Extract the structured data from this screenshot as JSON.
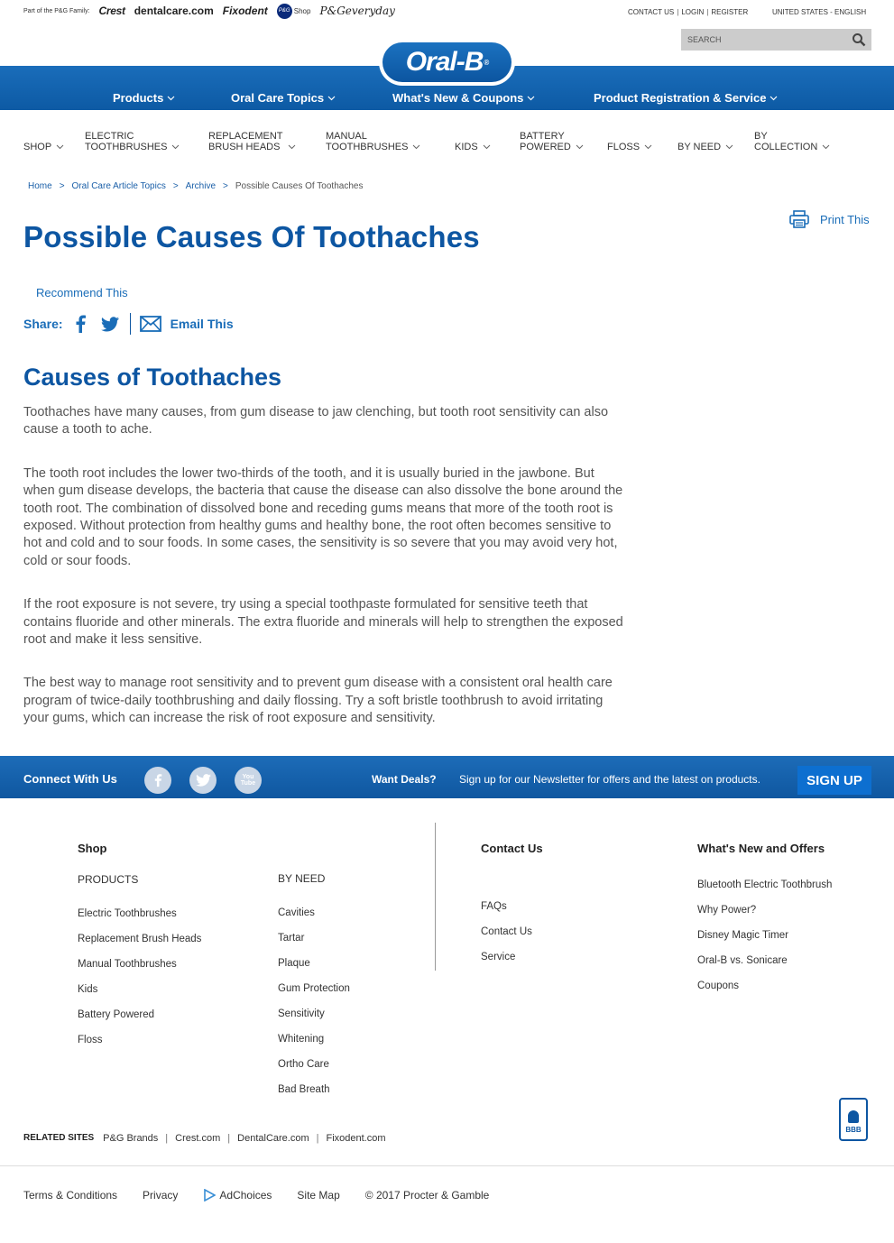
{
  "family": {
    "part_of": "Part of the P&G Family:",
    "brands": [
      "Crest",
      "dentalcare.com",
      "Fixodent",
      "Shop",
      "P&Geveryday"
    ],
    "pg_dot": "P&G"
  },
  "util": {
    "contact": "CONTACT US",
    "login": "LOGIN",
    "register": "REGISTER",
    "sep": "|",
    "locale": "UNITED STATES - ENGLISH"
  },
  "search": {
    "placeholder": "SEARCH"
  },
  "logo": {
    "text": "Oral-B",
    "reg": "®"
  },
  "mainnav": [
    {
      "label": "Products"
    },
    {
      "label": "Oral Care Topics"
    },
    {
      "label": "What's New & Coupons"
    },
    {
      "label": "Product Registration & Service"
    }
  ],
  "catnav": [
    {
      "l1": "",
      "l2": "SHOP"
    },
    {
      "l1": "ELECTRIC",
      "l2": "TOOTHBRUSHES"
    },
    {
      "l1": "REPLACEMENT",
      "l2": "BRUSH HEADS"
    },
    {
      "l1": "MANUAL",
      "l2": "TOOTHBRUSHES"
    },
    {
      "l1": "",
      "l2": "KIDS"
    },
    {
      "l1": "BATTERY",
      "l2": "POWERED"
    },
    {
      "l1": "",
      "l2": "FLOSS"
    },
    {
      "l1": "",
      "l2": "BY NEED"
    },
    {
      "l1": "BY",
      "l2": "COLLECTION"
    }
  ],
  "breadcrumb": {
    "items": [
      "Home",
      "Oral Care Article Topics",
      "Archive"
    ],
    "current": "Possible Causes Of Toothaches",
    "sep": ">"
  },
  "print": "Print This",
  "title": "Possible Causes Of Toothaches",
  "recommend": "Recommend This",
  "share": {
    "label": "Share:",
    "email": "Email This"
  },
  "subtitle": "Causes of Toothaches",
  "paragraphs": [
    "Toothaches have many causes, from gum disease to jaw clenching, but tooth root sensitivity can also cause a tooth to ache.",
    "The tooth root includes the lower two-thirds of the tooth, and it is usually buried in the jawbone. But when gum disease develops, the bacteria that cause the disease can also dissolve the bone around the tooth root. The combination of dissolved bone and receding gums means that more of the tooth root is exposed. Without protection from healthy gums and healthy bone, the root often becomes sensitive to hot and cold and to sour foods. In some cases, the sensitivity is so severe that you may avoid very hot, cold or sour foods.",
    "If the root exposure is not severe, try using a special toothpaste formulated for sensitive teeth that contains fluoride and other minerals. The extra fluoride and minerals will help to strengthen the exposed root and make it less sensitive.",
    "The best way to manage root sensitivity and to prevent gum disease with a consistent oral health care program of twice-daily toothbrushing and daily flossing. Try a soft bristle toothbrush to avoid irritating your gums, which can increase the risk of root exposure and sensitivity."
  ],
  "connect": {
    "label": "Connect With Us",
    "youtube": "You Tube",
    "deals": "Want Deals?",
    "newsletter": "Sign up for our Newsletter for offers and the latest on products.",
    "signup": "SIGN UP"
  },
  "footer": {
    "shop": "Shop",
    "products_head": "PRODUCTS",
    "products": [
      "Electric Toothbrushes",
      "Replacement Brush Heads",
      "Manual Toothbrushes",
      "Kids",
      "Battery Powered",
      "Floss"
    ],
    "byneed_head": "BY NEED",
    "byneed": [
      "Cavities",
      "Tartar",
      "Plaque",
      "Gum Protection",
      "Sensitivity",
      "Whitening",
      "Ortho Care",
      "Bad Breath"
    ],
    "contact_head": "Contact Us",
    "contact": [
      "FAQs",
      "Contact Us",
      "Service"
    ],
    "whatsnew_head": "What's New and Offers",
    "whatsnew": [
      "Bluetooth Electric Toothbrush",
      "Why Power?",
      "Disney Magic Timer",
      "Oral-B vs. Sonicare",
      "Coupons"
    ]
  },
  "related": {
    "label": "RELATED SITES",
    "items": [
      "P&G Brands",
      "Crest.com",
      "DentalCare.com",
      "Fixodent.com"
    ],
    "sep": "|"
  },
  "bbb": "BBB",
  "legal": [
    "Terms & Conditions",
    "Privacy",
    "AdChoices",
    "Site Map",
    "© 2017 Procter & Gamble"
  ],
  "colors": {
    "brand_blue": "#0d56a2",
    "link_blue": "#1a6db8",
    "nav_blue": "#1a6dba"
  }
}
